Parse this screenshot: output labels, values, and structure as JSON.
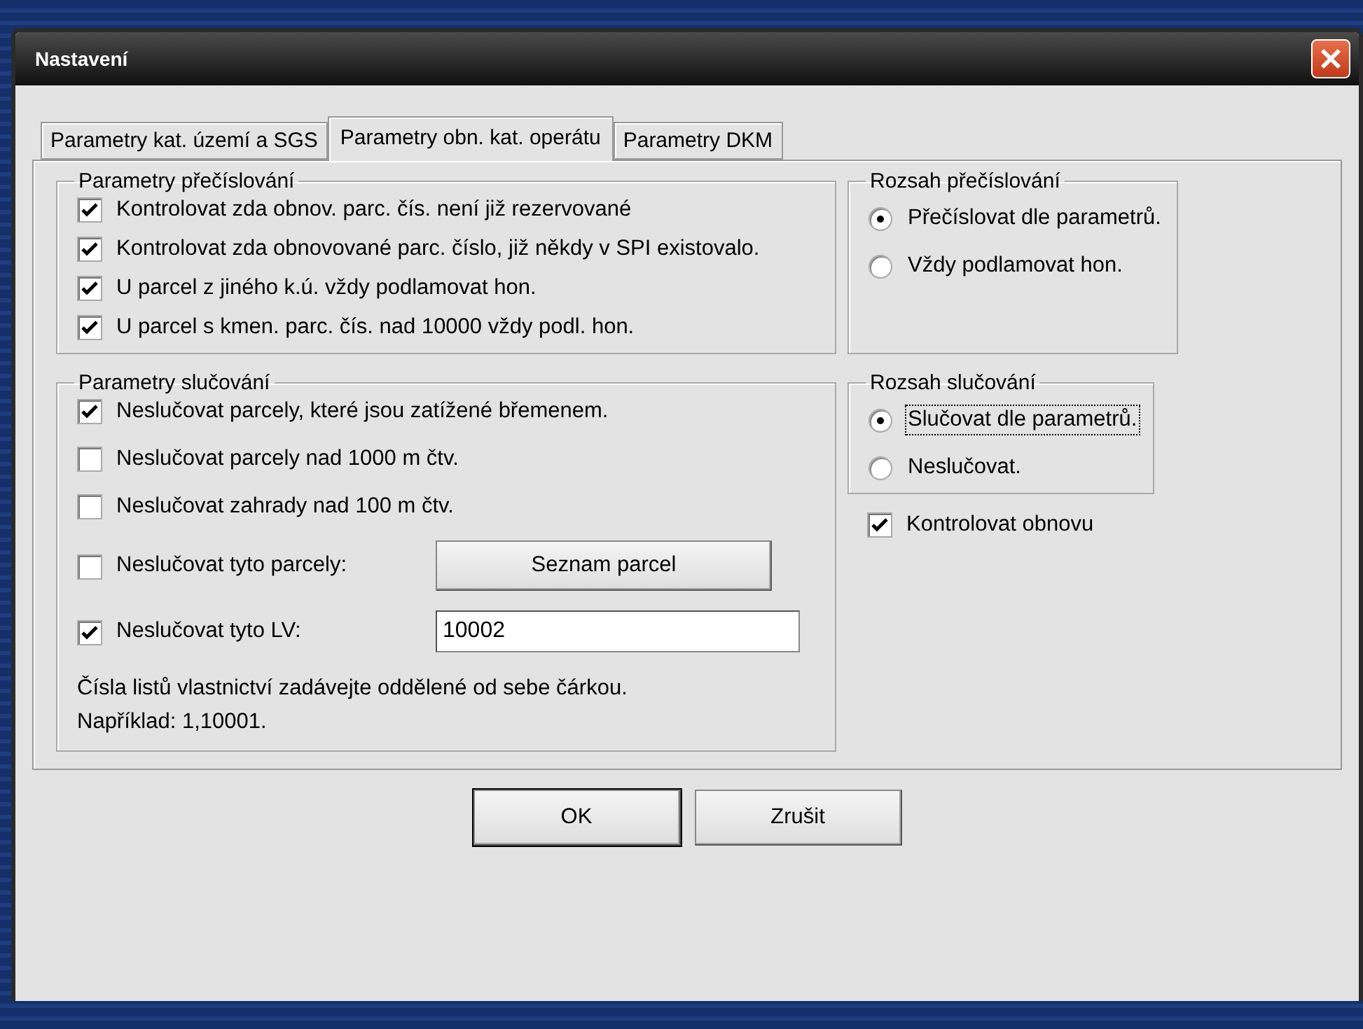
{
  "window": {
    "title": "Nastavení"
  },
  "tabs": [
    {
      "label": "Parametry kat. území a SGS",
      "selected": false
    },
    {
      "label": "Parametry obn. kat. operátu",
      "selected": true
    },
    {
      "label": "Parametry DKM",
      "selected": false
    }
  ],
  "renumbering_params": {
    "title": "Parametry přečíslování",
    "options": [
      {
        "label": "Kontrolovat zda obnov. parc. čís. není již rezervované",
        "checked": true
      },
      {
        "label": "Kontrolovat zda obnovované parc. číslo, již někdy v SPI existovalo.",
        "checked": true
      },
      {
        "label": "U parcel z jiného k.ú. vždy podlamovat hon.",
        "checked": true
      },
      {
        "label": "U parcel s kmen. parc. čís. nad 10000 vždy podl. hon.",
        "checked": true
      }
    ]
  },
  "renumbering_range": {
    "title": "Rozsah přečíslování",
    "options": [
      {
        "label": "Přečíslovat dle parametrů.",
        "selected": true,
        "focused": false
      },
      {
        "label": "Vždy podlamovat hon.",
        "selected": false,
        "focused": false
      }
    ]
  },
  "merge_params": {
    "title": "Parametry slučování",
    "options": [
      {
        "kind": "plain",
        "label": "Neslučovat parcely, které jsou zatížené břemenem.",
        "checked": true
      },
      {
        "kind": "plain",
        "label": "Neslučovat parcely nad 1000 m čtv.",
        "checked": false
      },
      {
        "kind": "plain",
        "label": "Neslučovat zahrady nad 100 m čtv.",
        "checked": false
      },
      {
        "kind": "button",
        "label": "Neslučovat tyto parcely:",
        "checked": false,
        "button": "Seznam parcel"
      },
      {
        "kind": "field",
        "label": "Neslučovat tyto LV:",
        "checked": true,
        "value": "10002"
      }
    ],
    "hint": "Čísla listů vlastnictví zadávejte oddělené od sebe čárkou.",
    "example": "Například: 1,10001."
  },
  "merge_range": {
    "title": "Rozsah slučování",
    "options": [
      {
        "label": "Slučovat dle parametrů.",
        "selected": true,
        "focused": true
      },
      {
        "label": "Neslučovat.",
        "selected": false,
        "focused": false
      }
    ]
  },
  "check_renewal": {
    "label": "Kontrolovat obnovu",
    "checked": true
  },
  "buttons": [
    {
      "label": "OK",
      "default": true
    },
    {
      "label": "Zrušit",
      "default": false
    }
  ]
}
